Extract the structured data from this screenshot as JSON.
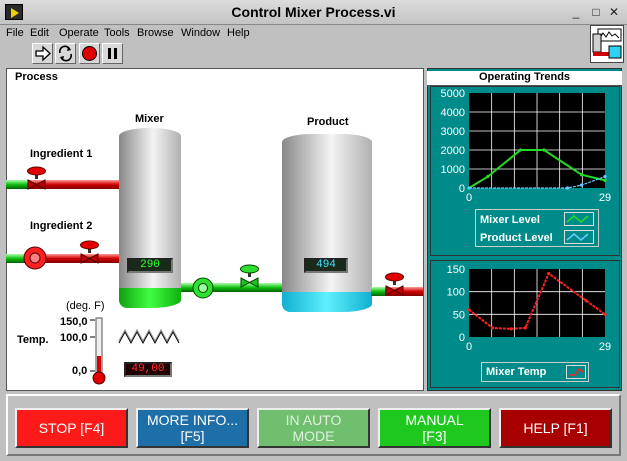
{
  "window": {
    "title": "Control Mixer Process.vi"
  },
  "menu": {
    "items": [
      "File",
      "Edit",
      "Operate",
      "Tools",
      "Browse",
      "Window",
      "Help"
    ]
  },
  "process": {
    "title": "Process",
    "mixer_label": "Mixer",
    "product_label": "Product",
    "ingredient1_label": "Ingredient 1",
    "ingredient2_label": "Ingredient 2",
    "mixer_level_readout": "290",
    "product_level_readout": "494",
    "temp_label": "Temp.",
    "temp_unit": "(deg. F)",
    "temp_ticks": [
      "150,0",
      "100,0",
      "0,0"
    ],
    "temp_readout": "49,00",
    "temp_level": 0.33,
    "mixer_level": 0.11,
    "product_level": 0.11
  },
  "trends": {
    "title": "Operating Trends",
    "legend": {
      "mixer_level": "Mixer Level",
      "product_level": "Product Level",
      "mixer_temp": "Mixer Temp"
    },
    "colors": {
      "mixer_level": "#22dd22",
      "product_level": "#66ccff",
      "mixer_temp": "#ff2020"
    }
  },
  "chart_data": [
    {
      "type": "line",
      "title": "",
      "x_ticks": [
        "0",
        "29"
      ],
      "y_ticks": [
        "0",
        "1000",
        "2000",
        "3000",
        "4000",
        "5000"
      ],
      "xlim": [
        0,
        29
      ],
      "ylim": [
        0,
        5000
      ],
      "grid": true,
      "legend_position": "bottom",
      "series": [
        {
          "name": "Mixer Level",
          "x": [
            0,
            4,
            11,
            16,
            24,
            29
          ],
          "y": [
            0,
            600,
            2000,
            2000,
            700,
            400
          ]
        },
        {
          "name": "Product Level",
          "x": [
            0,
            21,
            24,
            29
          ],
          "y": [
            0,
            0,
            150,
            600
          ]
        }
      ]
    },
    {
      "type": "line",
      "title": "",
      "x_ticks": [
        "0",
        "29"
      ],
      "y_ticks": [
        "0",
        "50",
        "100",
        "150"
      ],
      "xlim": [
        0,
        29
      ],
      "ylim": [
        0,
        150
      ],
      "grid": true,
      "legend_position": "bottom",
      "series": [
        {
          "name": "Mixer Temp",
          "x": [
            0,
            5,
            9,
            12,
            17,
            25,
            29
          ],
          "y": [
            60,
            20,
            18,
            20,
            140,
            80,
            50
          ]
        }
      ]
    }
  ],
  "buttons": {
    "stop": "STOP [F4]",
    "more_info": "MORE INFO...\n[F5]",
    "auto": "IN AUTO\nMODE",
    "manual": "MANUAL\n[F3]",
    "help": "HELP [F1]"
  }
}
